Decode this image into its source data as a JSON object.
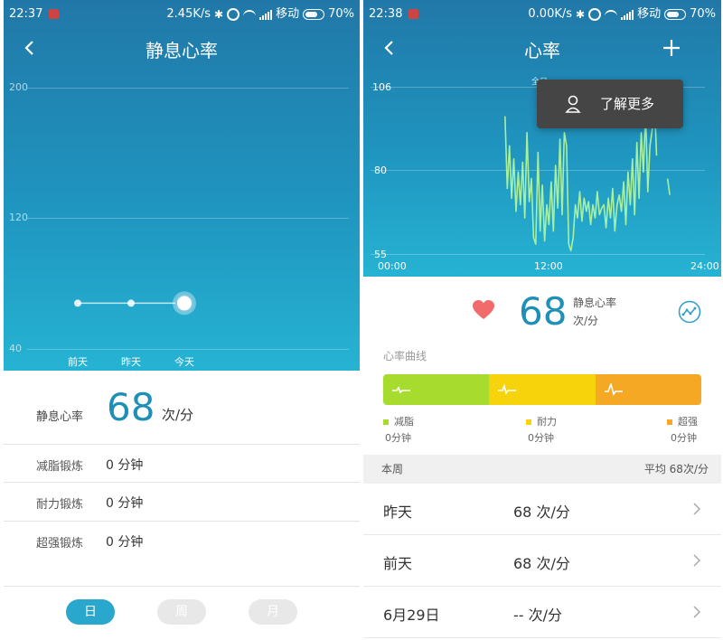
{
  "left": {
    "status": {
      "time": "22:37",
      "speed": "2.45K/s",
      "carrier": "移动",
      "battery": "70%"
    },
    "title": "静息心率",
    "chart": {
      "y_ticks": [
        "200",
        "120",
        "40"
      ],
      "days": [
        "前天",
        "昨天",
        "今天"
      ]
    },
    "summary": {
      "label": "静息心率",
      "value": "68",
      "unit": "次/分"
    },
    "rows": [
      {
        "label": "减脂锻炼",
        "value": "0 分钟"
      },
      {
        "label": "耐力锻炼",
        "value": "0 分钟"
      },
      {
        "label": "超强锻炼",
        "value": "0 分钟"
      }
    ],
    "tabs": {
      "day": "日",
      "week": "周",
      "month": "月"
    }
  },
  "right": {
    "status": {
      "time": "22:38",
      "speed": "0.00K/s",
      "carrier": "移动",
      "battery": "70%"
    },
    "title": "心率",
    "partial_label": "全日",
    "popup": {
      "text": "了解更多"
    },
    "chart": {
      "y_ticks": [
        "106",
        "80",
        "55"
      ],
      "x_ticks": [
        "00:00",
        "12:00",
        "24:00"
      ]
    },
    "heart_rate": {
      "value": "68",
      "label": "静息心率",
      "unit": "次/分"
    },
    "curve_title": "心率曲线",
    "zones": [
      {
        "name": "减脂",
        "value": "0分钟",
        "color": "#a7dc2e"
      },
      {
        "name": "耐力",
        "value": "0分钟",
        "color": "#f6d30a"
      },
      {
        "name": "超强",
        "value": "0分钟",
        "color": "#f5a823"
      }
    ],
    "week": {
      "label": "本周",
      "average": "平均 68次/分"
    },
    "days": [
      {
        "date": "昨天",
        "value": "68 次/分"
      },
      {
        "date": "前天",
        "value": "68 次/分"
      },
      {
        "date": "6月29日",
        "value": "-- 次/分"
      }
    ]
  },
  "chart_data": [
    {
      "type": "line",
      "title": "静息心率",
      "categories": [
        "前天",
        "昨天",
        "今天"
      ],
      "values": [
        68,
        68,
        68
      ],
      "ylim": [
        40,
        200
      ],
      "yticks": [
        40,
        120,
        200
      ]
    },
    {
      "type": "line",
      "title": "心率",
      "xlabel": "",
      "ylabel": "",
      "xlim": [
        "00:00",
        "24:00"
      ],
      "ylim": [
        55,
        106
      ],
      "yticks": [
        55,
        80,
        106
      ],
      "x": [
        "08:50",
        "09:00",
        "09:10",
        "09:20",
        "09:30",
        "09:40",
        "09:50",
        "10:00",
        "10:10",
        "10:20",
        "10:30",
        "10:40",
        "10:50",
        "11:00",
        "11:10",
        "11:20",
        "11:30",
        "11:40",
        "11:50",
        "12:00",
        "12:10",
        "12:20",
        "12:30",
        "12:40",
        "12:50",
        "13:00",
        "13:10",
        "13:20",
        "13:30",
        "13:40",
        "13:50",
        "14:00",
        "14:10",
        "14:20",
        "14:30",
        "14:40",
        "14:50",
        "15:00",
        "15:10",
        "15:20",
        "15:30",
        "15:40",
        "15:50",
        "16:00",
        "16:10",
        "16:20",
        "16:30",
        "16:40",
        "16:50",
        "17:00",
        "17:10",
        "17:20",
        "17:30",
        "17:40",
        "17:50",
        "18:00",
        "18:10",
        "18:20",
        "18:30",
        "18:40",
        "18:50",
        "19:00",
        "19:10",
        "19:20",
        "19:30",
        "19:40",
        "19:50",
        "20:00",
        "20:10",
        "20:20",
        "20:30",
        "20:40",
        "20:50",
        "21:00",
        "21:10",
        "21:20"
      ],
      "values": [
        97,
        75,
        88,
        72,
        84,
        68,
        80,
        70,
        83,
        66,
        92,
        71,
        78,
        60,
        58,
        86,
        62,
        76,
        59,
        70,
        64,
        77,
        62,
        82,
        69,
        90,
        67,
        92,
        88,
        58,
        56,
        60,
        70,
        66,
        74,
        65,
        72,
        68,
        71,
        64,
        70,
        66,
        74,
        67,
        69,
        70,
        63,
        72,
        66,
        75,
        62,
        70,
        73,
        68,
        77,
        64,
        80,
        70,
        84,
        67,
        89,
        72,
        92,
        80,
        98,
        74,
        88,
        93,
        102,
        85,
        null,
        null,
        null,
        null,
        78,
        73
      ]
    }
  ]
}
